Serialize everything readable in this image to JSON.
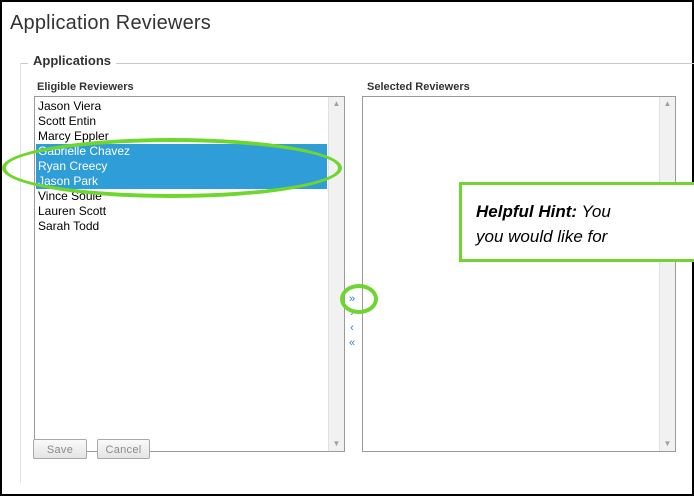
{
  "page_title": "Application Reviewers",
  "section_legend": "Applications",
  "eligible": {
    "label": "Eligible Reviewers",
    "items": [
      {
        "name": "Jason Viera",
        "selected": false
      },
      {
        "name": "Scott Entin",
        "selected": false
      },
      {
        "name": "Marcy Eppler",
        "selected": false
      },
      {
        "name": "Gabrielle Chavez",
        "selected": true
      },
      {
        "name": "Ryan Creecy",
        "selected": true
      },
      {
        "name": "Jason Park",
        "selected": true
      },
      {
        "name": "Vince Soule",
        "selected": false
      },
      {
        "name": "Lauren Scott",
        "selected": false
      },
      {
        "name": "Sarah Todd",
        "selected": false
      }
    ]
  },
  "selected": {
    "label": "Selected Reviewers",
    "items": []
  },
  "move_buttons": {
    "move_all_right": "»",
    "move_right": "›",
    "move_left": "‹",
    "move_all_left": "«"
  },
  "hint": {
    "title": "Helpful Hint:",
    "line1_rest": " You",
    "line2": "you would like for"
  },
  "buttons": {
    "save": "Save",
    "cancel": "Cancel"
  },
  "colors": {
    "selection": "#2f9ed8",
    "highlight": "#6fd62f",
    "arrows": "#2f82c8"
  }
}
